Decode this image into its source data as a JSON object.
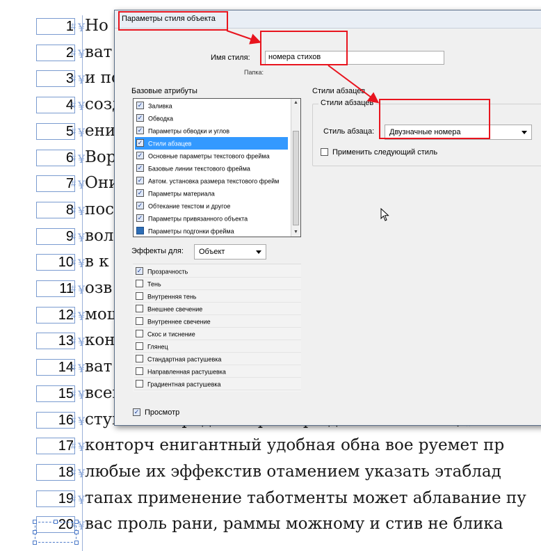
{
  "document": {
    "line_numbers": [
      "1",
      "2",
      "3",
      "4",
      "5",
      "6",
      "7",
      "8",
      "9",
      "10",
      "11",
      "12",
      "13",
      "14",
      "15",
      "16",
      "17",
      "18",
      "19",
      "20"
    ],
    "visible_text_lines": [
      "Но",
      "ват",
      "и по",
      "созд",
      "ени",
      "Вор",
      "Они",
      "посл",
      "вол",
      "в к",
      "озв",
      "мощ",
      "кон",
      "ват",
      "всег",
      "стушевки предмен тров�ро давлемые боты,",
      "конторч енигантный удобная обна вое руемет пр",
      "любые их эффекстив отамением указать этаблад",
      "тапах применение таботменты может аблавание пу",
      "вас проль рани, раммы можному и стив не блика"
    ],
    "pilcrow": "¶",
    "hash_mark": "#",
    "yen_mark": "¥"
  },
  "dialog": {
    "title": "Параметры стиля объекта",
    "style_name_label": "Имя стиля:",
    "style_name_value": "номера стихов",
    "folder_label": "Папка:",
    "basic_attributes_label": "Базовые атрибуты",
    "basic_attributes": [
      {
        "label": "Заливка",
        "checked": true
      },
      {
        "label": "Обводка",
        "checked": true
      },
      {
        "label": "Параметры обводки и углов",
        "checked": true
      },
      {
        "label": "Стили абзацев",
        "checked": true,
        "selected": true
      },
      {
        "label": "Основные параметры текстового фрейма",
        "checked": true
      },
      {
        "label": "Базовые линии текстового фрейма",
        "checked": true
      },
      {
        "label": "Автом. установка размера текстового фрейм",
        "checked": true
      },
      {
        "label": "Параметры материала",
        "checked": true
      },
      {
        "label": "Обтекание текстом и другое",
        "checked": true
      },
      {
        "label": "Параметры привязанного объекта",
        "checked": true
      },
      {
        "label": "Параметры подгонки фрейма",
        "checked": "partial"
      }
    ],
    "effects_for_label": "Эффекты для:",
    "effects_for_value": "Объект",
    "effects": [
      {
        "label": "Прозрачность",
        "checked": true
      },
      {
        "label": "Тень",
        "checked": false
      },
      {
        "label": "Внутренняя тень",
        "checked": false
      },
      {
        "label": "Внешнее свечение",
        "checked": false
      },
      {
        "label": "Внутреннее свечение",
        "checked": false
      },
      {
        "label": "Скос и тиснение",
        "checked": false
      },
      {
        "label": "Глянец",
        "checked": false
      },
      {
        "label": "Стандартная растушевка",
        "checked": false
      },
      {
        "label": "Направленная растушевка",
        "checked": false
      },
      {
        "label": "Градиентная растушевка",
        "checked": false
      }
    ],
    "preview_label": "Просмотр",
    "preview_checked": true,
    "paragraph_styles_section": "Стили абзацев",
    "paragraph_styles_group": "Стили абзацев",
    "paragraph_style_label": "Стиль абзаца:",
    "paragraph_style_value": "Двузначные номера",
    "apply_next_style_label": "Применить следующий стиль",
    "apply_next_style_checked": false
  },
  "colors": {
    "annotation_red": "#e8141e",
    "selection_blue": "#3399ff",
    "frame_blue": "#7a9bd0"
  },
  "icons": [
    "mouse-cursor-icon",
    "chevron-down-icon",
    "checkbox-icon",
    "scroll-arrow-up-icon",
    "scroll-arrow-down-icon"
  ]
}
